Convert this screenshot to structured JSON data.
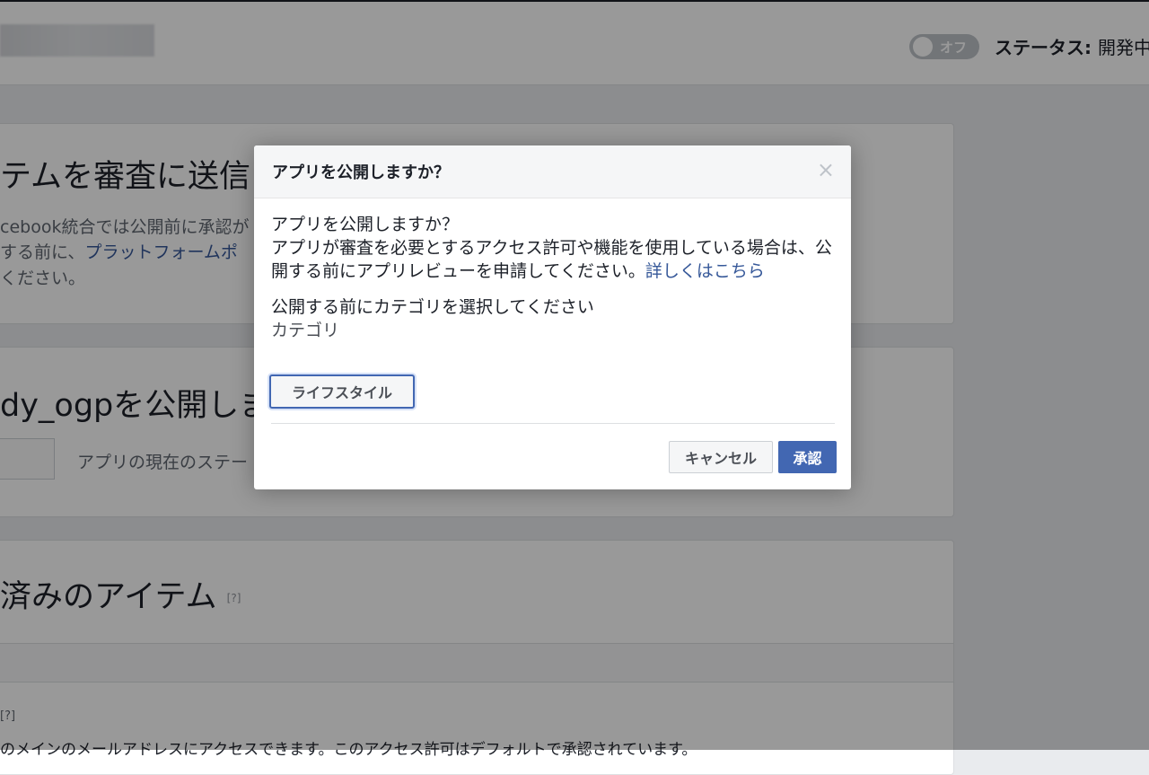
{
  "header": {
    "toggle_label": "オフ",
    "status_label": "ステータス:",
    "status_value": "開発中"
  },
  "background": {
    "card1": {
      "title": "テムを審査に送信",
      "line1": "cebook統合では公開前に承認が",
      "line2_prefix": "する前に、",
      "line2_link": "プラットフォームポ",
      "line3": "ください。"
    },
    "card2": {
      "title": "dy_ogpを公開しま",
      "status_text": "アプリの現在のステー"
    },
    "card3": {
      "title": "済みのアイテム",
      "help": "[?]",
      "help2": "[?]",
      "line": "のメインのメールアドレスにアクセスできます。このアクセス許可はデフォルトで承認されています。"
    }
  },
  "dialog": {
    "title": "アプリを公開しますか？",
    "close_icon": "×",
    "question": "アプリを公開しますか？",
    "message": "アプリが審査を必要とするアクセス許可や機能を使用している場合は、公開する前にアプリレビューを申請してください。",
    "learn_more": "詳しくはこちら",
    "category_prompt": "公開する前にカテゴリを選択してください",
    "category_label": "カテゴリ",
    "category_value": "ライフスタイル",
    "cancel_label": "キャンセル",
    "confirm_label": "承認"
  }
}
